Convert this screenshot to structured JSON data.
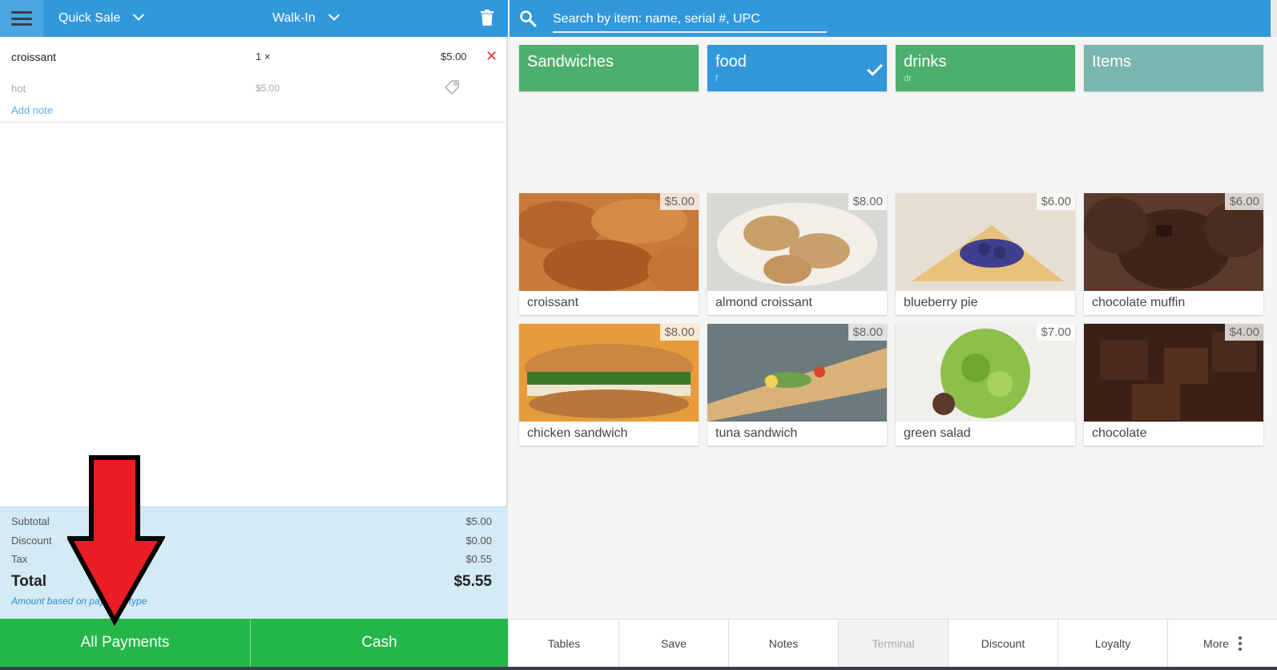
{
  "header": {
    "menu_icon": "hamburger-icon",
    "sale_type": "Quick Sale",
    "customer": "Walk-In",
    "trash_icon": "trash-icon"
  },
  "cart": {
    "items": [
      {
        "name": "croissant",
        "qty": "1 ×",
        "price": "$5.00",
        "modifier": "hot",
        "modifier_price": "$5.00",
        "add_note": "Add note"
      }
    ]
  },
  "totals": {
    "subtotal_label": "Subtotal",
    "subtotal": "$5.00",
    "discount_label": "Discount",
    "discount": "$0.00",
    "tax_label": "Tax",
    "tax": "$0.55",
    "total_label": "Total",
    "total": "$5.55",
    "note": "Amount based on payment type"
  },
  "payments": {
    "all": "All Payments",
    "cash": "Cash"
  },
  "search": {
    "placeholder": "Search by item: name, serial #, UPC"
  },
  "categories": [
    {
      "name": "Sandwiches",
      "sub": "",
      "color": "#4caf6e",
      "selected": false
    },
    {
      "name": "food",
      "sub": "f",
      "color": "#3298dc",
      "selected": true
    },
    {
      "name": "drinks",
      "sub": "dr",
      "color": "#4caf6e",
      "selected": false
    },
    {
      "name": "Items",
      "sub": "",
      "color": "#7ab5af",
      "selected": false
    }
  ],
  "products": [
    {
      "name": "croissant",
      "price": "$5.00"
    },
    {
      "name": "almond croissant",
      "price": "$8.00"
    },
    {
      "name": "blueberry pie",
      "price": "$6.00"
    },
    {
      "name": "chocolate muffin",
      "price": "$6.00"
    },
    {
      "name": "chicken sandwich",
      "price": "$8.00"
    },
    {
      "name": "tuna sandwich",
      "price": "$8.00"
    },
    {
      "name": "green salad",
      "price": "$7.00"
    },
    {
      "name": "chocolate",
      "price": "$4.00"
    }
  ],
  "bottom_bar": [
    {
      "label": "Tables"
    },
    {
      "label": "Save"
    },
    {
      "label": "Notes"
    },
    {
      "label": "Terminal",
      "disabled": true
    },
    {
      "label": "Discount"
    },
    {
      "label": "Loyalty"
    },
    {
      "label": "More",
      "icon": "more-vertical-icon"
    }
  ],
  "colors": {
    "header": "#3298dc",
    "pay": "#25b64a",
    "totals_bg": "#d4eaf4",
    "arrow": "#ec1c24"
  }
}
